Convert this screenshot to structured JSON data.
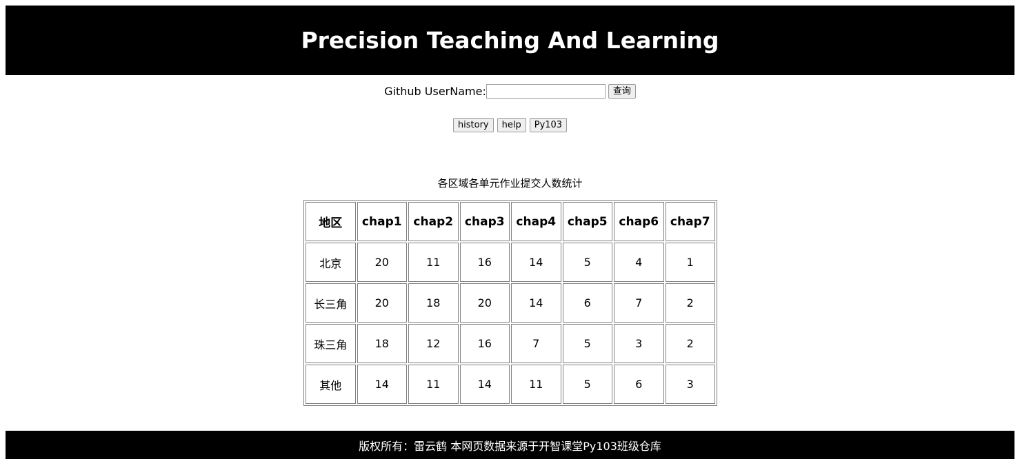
{
  "header": {
    "title": "Precision Teaching And Learning"
  },
  "search": {
    "label": "Github UserName:",
    "value": "",
    "placeholder": "",
    "query_button": "查询"
  },
  "nav": {
    "history": "history",
    "help": "help",
    "py103": "Py103"
  },
  "table": {
    "caption": "各区域各单元作业提交人数统计",
    "headers": [
      "地区",
      "chap1",
      "chap2",
      "chap3",
      "chap4",
      "chap5",
      "chap6",
      "chap7"
    ],
    "rows": [
      [
        "北京",
        "20",
        "11",
        "16",
        "14",
        "5",
        "4",
        "1"
      ],
      [
        "长三角",
        "20",
        "18",
        "20",
        "14",
        "6",
        "7",
        "2"
      ],
      [
        "珠三角",
        "18",
        "12",
        "16",
        "7",
        "5",
        "3",
        "2"
      ],
      [
        "其他",
        "14",
        "11",
        "14",
        "11",
        "5",
        "6",
        "3"
      ]
    ]
  },
  "footer": {
    "text": "版权所有：雷云鹤 本网页数据来源于开智课堂Py103班级仓库"
  }
}
